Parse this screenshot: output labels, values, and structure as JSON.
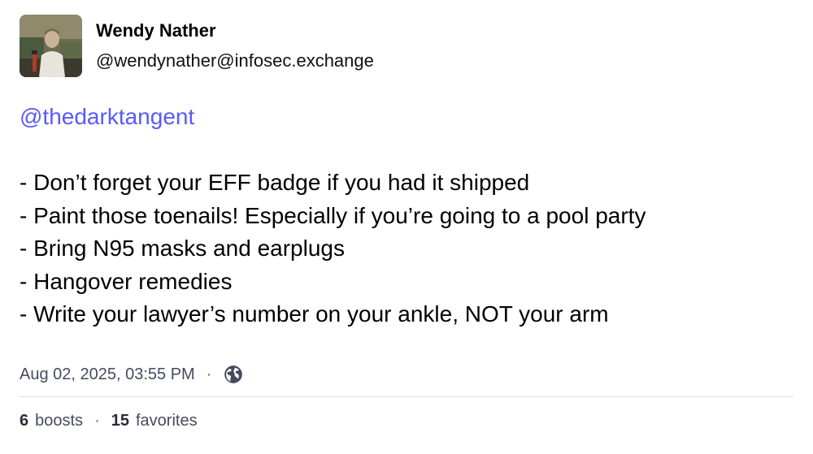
{
  "author": {
    "display_name": "Wendy Nather",
    "handle": "@wendynather@infosec.exchange",
    "avatar_icon": "user-avatar-photo"
  },
  "post": {
    "mention": "@thedarktangent",
    "lines": [
      "- Don’t forget your EFF badge if you had it shipped",
      "- Paint those toenails! Especially if you’re going to a pool party",
      "- Bring N95 masks and earplugs",
      "- Hangover remedies",
      "- Write your lawyer’s number on your ankle, NOT your arm"
    ],
    "timestamp": "Aug 02, 2025, 03:55 PM",
    "separator": "·",
    "visibility_icon": "globe-icon"
  },
  "stats": {
    "boosts_count": "6",
    "boosts_label": "boosts",
    "favorites_count": "15",
    "favorites_label": "favorites",
    "separator": "·"
  },
  "colors": {
    "mention": "#595aff",
    "meta_text": "#444b5d",
    "divider": "#e0e2ea"
  }
}
